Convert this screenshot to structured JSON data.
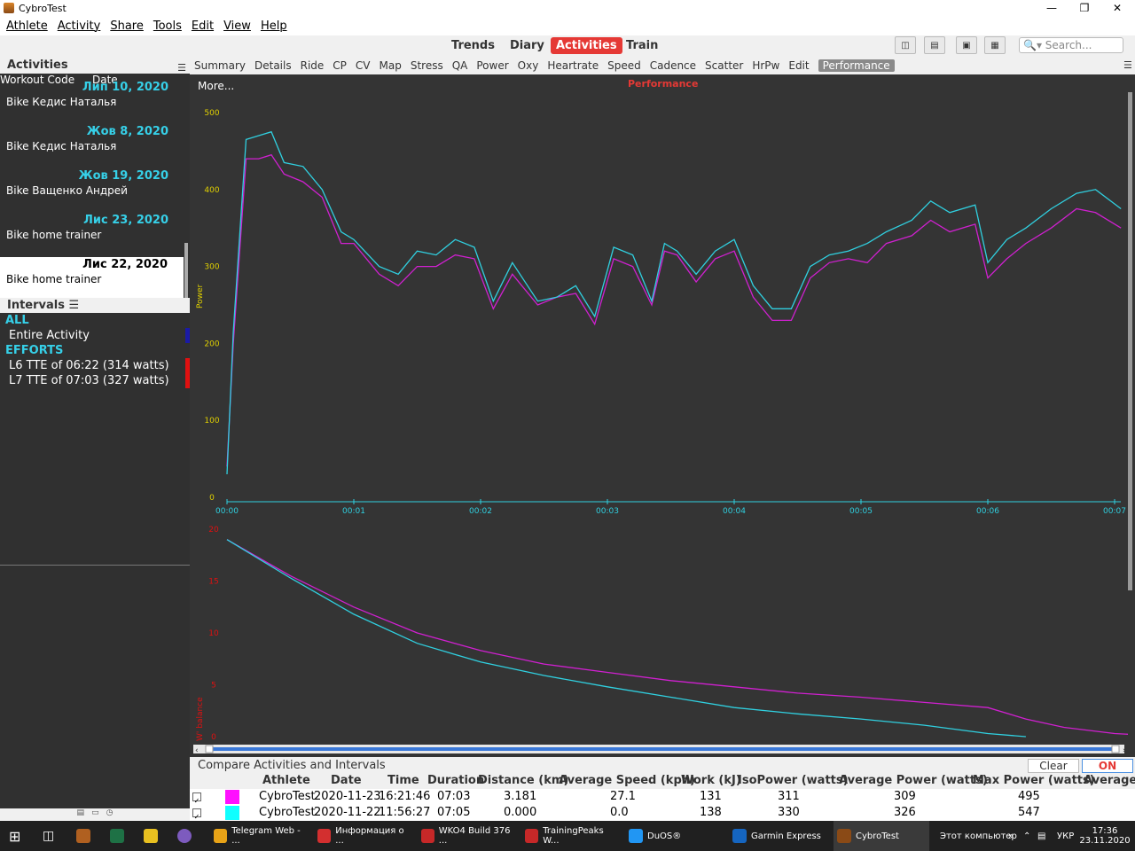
{
  "window": {
    "title": "CybroTest"
  },
  "menu": [
    "Athlete",
    "Activity",
    "Share",
    "Tools",
    "Edit",
    "View",
    "Help"
  ],
  "views": [
    "Trends",
    "Diary",
    "Activities",
    "Train"
  ],
  "active_view": "Activities",
  "search": {
    "placeholder": "Search..."
  },
  "sidebar": {
    "activities_title": "Activities",
    "col_workout": "Workout Code",
    "col_date": "Date",
    "items": [
      {
        "date": "Лип 10, 2020",
        "name": "Bike Кедис Наталья"
      },
      {
        "date": "Жов 8, 2020",
        "name": "Bike Кедис Наталья"
      },
      {
        "date": "Жов 19, 2020",
        "name": "Bike Ващенко Андрей"
      },
      {
        "date": "Лис 23, 2020",
        "name": "Bike home trainer"
      },
      {
        "date": "Лис 22, 2020",
        "name": "Bike home trainer"
      }
    ],
    "intervals_title": "Intervals",
    "groups": [
      {
        "label": "ALL",
        "items": [
          {
            "text": "Entire Activity",
            "color": "#1a1aa6"
          }
        ]
      },
      {
        "label": "EFFORTS",
        "items": [
          {
            "text": "L6 TTE of 06:22  (314 watts)",
            "color": "#e01010"
          },
          {
            "text": "L7 TTE of 07:03  (327 watts)",
            "color": "#e01010"
          }
        ]
      }
    ]
  },
  "tabs": [
    "Summary",
    "Details",
    "Ride",
    "CP",
    "CV",
    "Map",
    "Stress",
    "QA",
    "Power",
    "Oxy",
    "Heartrate",
    "Speed",
    "Cadence",
    "Scatter",
    "HrPw",
    "Edit",
    "Performance"
  ],
  "active_tab": "Performance",
  "chart": {
    "more_label": "More...",
    "title": "Performance",
    "colors": {
      "series1": "#d020d0",
      "series2": "#30d0e0",
      "power_axis": "#e0d000",
      "wbal_axis": "#e01010",
      "time_axis": "#30d0e0"
    }
  },
  "chart_data": [
    {
      "type": "line",
      "ylabel": "Power",
      "ylim": [
        0,
        500
      ],
      "yticks": [
        "0",
        "100",
        "200",
        "300",
        "400",
        "500"
      ],
      "xticks": [
        "00:00",
        "00:01",
        "00:02",
        "00:03",
        "00:04",
        "00:05",
        "00:06",
        "00:07"
      ],
      "x_minutes": [
        0,
        0.05,
        0.15,
        0.25,
        0.35,
        0.45,
        0.6,
        0.75,
        0.9,
        1.0,
        1.2,
        1.35,
        1.5,
        1.65,
        1.8,
        1.95,
        2.1,
        2.25,
        2.45,
        2.6,
        2.75,
        2.9,
        3.05,
        3.2,
        3.35,
        3.45,
        3.55,
        3.7,
        3.85,
        4.0,
        4.15,
        4.3,
        4.45,
        4.6,
        4.75,
        4.9,
        5.05,
        5.2,
        5.4,
        5.55,
        5.7,
        5.9,
        6.0,
        6.15,
        6.3,
        6.5,
        6.7,
        6.85,
        7.05
      ],
      "series": [
        {
          "name": "CybroTest 2020-11-23",
          "values": [
            40,
            200,
            440,
            440,
            445,
            420,
            410,
            390,
            330,
            330,
            290,
            275,
            300,
            300,
            315,
            310,
            245,
            290,
            250,
            260,
            265,
            225,
            310,
            300,
            250,
            320,
            315,
            280,
            310,
            320,
            260,
            230,
            230,
            285,
            305,
            310,
            305,
            330,
            340,
            360,
            345,
            355,
            285,
            310,
            330,
            350,
            375,
            370,
            350
          ]
        },
        {
          "name": "CybroTest 2020-11-22",
          "values": [
            30,
            215,
            465,
            470,
            475,
            435,
            430,
            400,
            345,
            335,
            300,
            290,
            320,
            315,
            335,
            325,
            255,
            305,
            255,
            260,
            275,
            235,
            325,
            315,
            255,
            330,
            320,
            290,
            320,
            335,
            275,
            245,
            245,
            300,
            315,
            320,
            330,
            345,
            360,
            385,
            370,
            380,
            305,
            335,
            350,
            375,
            395,
            400,
            375
          ]
        }
      ]
    },
    {
      "type": "line",
      "ylabel": "W' balance",
      "ylim": [
        0,
        20
      ],
      "yticks": [
        "0",
        "5",
        "10",
        "15",
        "20"
      ],
      "x_minutes": [
        0,
        0.5,
        1.0,
        1.5,
        2.0,
        2.5,
        3.0,
        3.5,
        4.0,
        4.5,
        5.0,
        5.5,
        6.0,
        6.3,
        6.6,
        7.0,
        7.3,
        7.55
      ],
      "series": [
        {
          "name": "CybroTest 2020-11-23",
          "values": [
            19,
            15.5,
            12.5,
            10,
            8.3,
            7,
            6.2,
            5.4,
            4.8,
            4.2,
            3.8,
            3.3,
            2.8,
            1.7,
            0.9,
            0.3,
            0.1,
            0
          ]
        },
        {
          "name": "CybroTest 2020-11-22",
          "values": [
            19,
            15.3,
            11.8,
            9,
            7.2,
            5.9,
            4.8,
            3.8,
            2.8,
            2.2,
            1.7,
            1.1,
            0.3,
            0
          ]
        }
      ]
    }
  ],
  "compare": {
    "title": "Compare Activities and Intervals",
    "clear_label": "Clear",
    "on_label": "ON",
    "headers": [
      "Athlete",
      "Date",
      "Time",
      "Duration",
      "Distance (km)",
      "Average Speed (kph)",
      "Work (kJ)",
      "IsoPower (watts)",
      "Average Power (watts)",
      "Max Power (watts)",
      "Average"
    ],
    "rows": [
      {
        "color": "#ff10ff",
        "athlete": "CybroTest",
        "date": "2020-11-23",
        "time": "16:21:46",
        "duration": "07:03",
        "distance": "3.181",
        "speed": "27.1",
        "work": "131",
        "iso": "311",
        "avg": "309",
        "max": "495"
      },
      {
        "color": "#10ffff",
        "athlete": "CybroTest",
        "date": "2020-11-22",
        "time": "11:56:27",
        "duration": "07:05",
        "distance": "0.000",
        "speed": "0.0",
        "work": "138",
        "iso": "330",
        "avg": "326",
        "max": "547"
      }
    ]
  },
  "taskbar": {
    "apps": [
      {
        "label": "Telegram Web - ...",
        "color": "#e8a317"
      },
      {
        "label": "Информация о ...",
        "color": "#d32f2f"
      },
      {
        "label": "WKO4 Build 376 ...",
        "color": "#c62828"
      },
      {
        "label": "TrainingPeaks W...",
        "color": "#c62828"
      },
      {
        "label": "DuOS®",
        "color": "#2196f3"
      },
      {
        "label": "Garmin Express",
        "color": "#1565c0"
      },
      {
        "label": "CybroTest",
        "color": "#8a4a16"
      }
    ],
    "tray_text": "Этот компьютер",
    "lang": "УКР",
    "time": "17:36",
    "date": "23.11.2020"
  }
}
